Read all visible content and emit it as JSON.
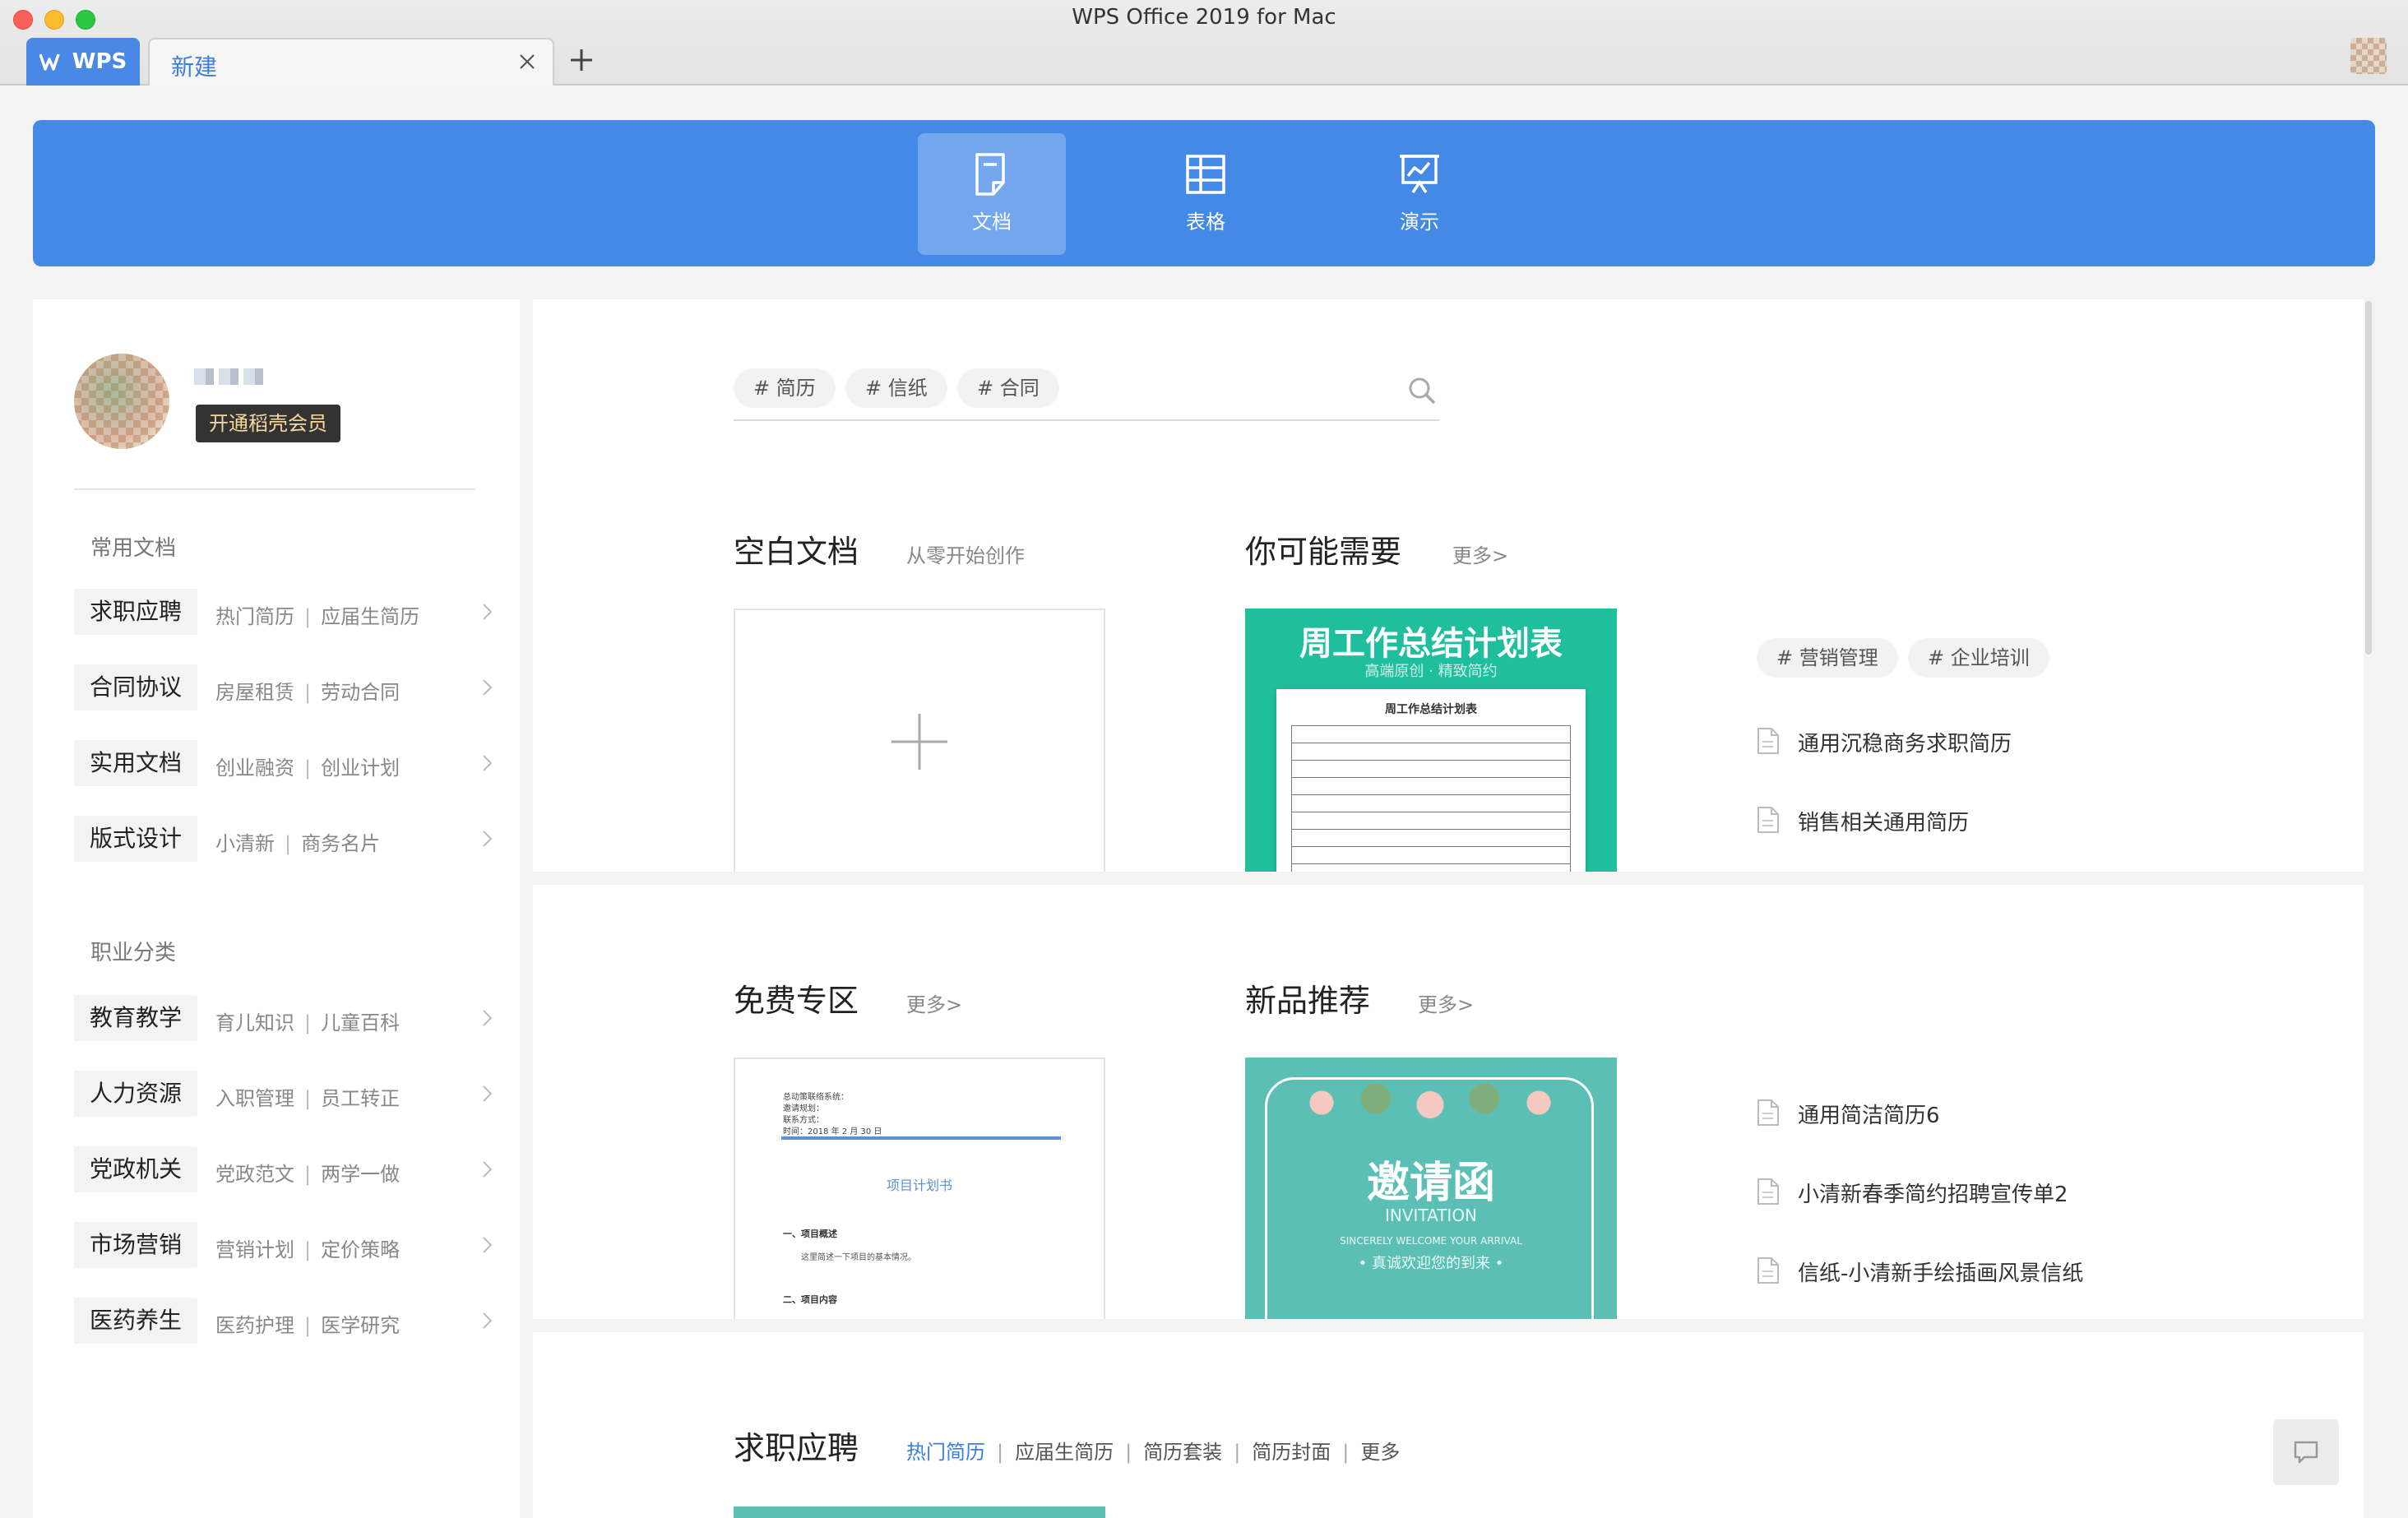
{
  "window": {
    "title": "WPS Office 2019 for Mac"
  },
  "tabs": {
    "home_label": "WPS",
    "doc_tab_label": "新建"
  },
  "categories": [
    {
      "label": "文档",
      "icon": "document-icon",
      "active": true
    },
    {
      "label": "表格",
      "icon": "spreadsheet-icon",
      "active": false
    },
    {
      "label": "演示",
      "icon": "presentation-icon",
      "active": false
    }
  ],
  "user": {
    "vip_label": "开通稻壳会员"
  },
  "sidebar": {
    "common_heading": "常用文档",
    "common": [
      {
        "label": "求职应聘",
        "links": [
          "热门简历",
          "应届生简历"
        ]
      },
      {
        "label": "合同协议",
        "links": [
          "房屋租赁",
          "劳动合同"
        ]
      },
      {
        "label": "实用文档",
        "links": [
          "创业融资",
          "创业计划"
        ]
      },
      {
        "label": "版式设计",
        "links": [
          "小清新",
          "商务名片"
        ]
      }
    ],
    "career_heading": "职业分类",
    "career": [
      {
        "label": "教育教学",
        "links": [
          "育儿知识",
          "儿童百科"
        ]
      },
      {
        "label": "人力资源",
        "links": [
          "入职管理",
          "员工转正"
        ]
      },
      {
        "label": "党政机关",
        "links": [
          "党政范文",
          "两学一做"
        ]
      },
      {
        "label": "市场营销",
        "links": [
          "营销计划",
          "定价策略"
        ]
      },
      {
        "label": "医药养生",
        "links": [
          "医药护理",
          "医学研究"
        ]
      }
    ]
  },
  "search": {
    "chips": [
      "# 简历",
      "# 信纸",
      "# 合同"
    ]
  },
  "blank_section": {
    "title": "空白文档",
    "subtitle": "从零开始创作"
  },
  "suggest_section": {
    "title": "你可能需要",
    "more": "更多>",
    "thumb_title": "周工作总结计划表",
    "thumb_subtitle": "高端原创 · 精致简约",
    "thumb_paper_title": "周工作总结计划表",
    "tags": [
      "# 营销管理",
      "# 企业培训"
    ],
    "files": [
      "通用沉稳商务求职简历",
      "销售相关通用简历"
    ]
  },
  "free_section": {
    "title": "免费专区",
    "more": "更多>",
    "doc_header": "总动策联络系统：\n邀请规划：\n联系方式：\n时间：2018 年 2 月 30 日",
    "doc_title": "项目计划书",
    "doc_h1": "一、项目概述",
    "doc_p": "这里简述一下项目的基本情况。",
    "doc_h2": "二、项目内容"
  },
  "new_section": {
    "title": "新品推荐",
    "more": "更多>",
    "invite_title": "邀请函",
    "invite_en": "INVITATION",
    "invite_small": "SINCERELY WELCOME YOUR ARRIVAL",
    "invite_cn": "• 真诚欢迎您的到来 •",
    "files": [
      "通用简洁简历6",
      "小清新春季简约招聘宣传单2",
      "信纸-小清新手绘插画风景信纸"
    ]
  },
  "job_section": {
    "title": "求职应聘",
    "tabs": [
      "热门简历",
      "应届生简历",
      "简历套装",
      "简历封面",
      "更多"
    ]
  },
  "colors": {
    "accent": "#4489e6",
    "link": "#3a7ee0",
    "teal": "#1fbf9d"
  }
}
